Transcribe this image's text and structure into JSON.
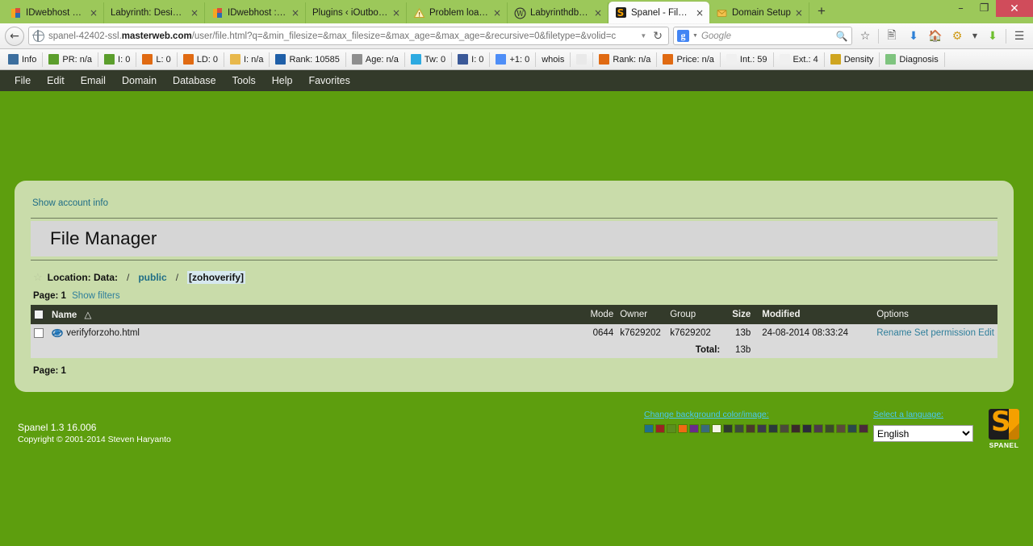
{
  "browser": {
    "tabs": [
      {
        "label": "IDwebhost We...",
        "favicon": "idwebhost-icon",
        "active": false
      },
      {
        "label": "Labyrinth: Design a...",
        "favicon": "blank-icon",
        "active": false
      },
      {
        "label": "IDwebhost :: H...",
        "favicon": "idwebhost-icon",
        "active": false
      },
      {
        "label": "Plugins ‹ iOutboun...",
        "favicon": "blank-icon",
        "active": false
      },
      {
        "label": "Problem loadi...",
        "favicon": "warning-icon",
        "active": false
      },
      {
        "label": "Labyrinthdb.c...",
        "favicon": "wordpress-icon",
        "active": false
      },
      {
        "label": "Spanel - File M...",
        "favicon": "spanel-icon",
        "active": true
      },
      {
        "label": "Domain Setup",
        "favicon": "mail-icon",
        "active": false
      }
    ],
    "new_tab_label": "+",
    "close_label": "×",
    "window_controls": {
      "minimize": "–",
      "restore": "❐",
      "close": "✕"
    },
    "url": {
      "host_prefix": "spanel-42402-ssl.",
      "host_bold": "masterweb.com",
      "path": "/user/file.html?q=&min_filesize=&max_filesize=&max_age=&max_age=&recursive=0&filetype=&volid=c"
    },
    "search": {
      "engine": "Google",
      "placeholder": "Google"
    },
    "nav_icons": [
      "back-icon",
      "bookmark-star-icon",
      "reader-icon",
      "downloads-icon",
      "home-icon",
      "addon-icon",
      "download-helper-icon",
      "menu-icon"
    ]
  },
  "seobar": {
    "items": [
      {
        "label": "Info",
        "icon": "info-icon",
        "color": "#3c6e9e"
      },
      {
        "label": "PR: n/a",
        "icon": "pagerank-icon",
        "color": "#5b9e2c"
      },
      {
        "label": "I: 0",
        "icon": "pagerank-icon",
        "color": "#5b9e2c"
      },
      {
        "label": "L: 0",
        "icon": "links-icon",
        "color": "#e06a12"
      },
      {
        "label": "LD: 0",
        "icon": "links-icon",
        "color": "#e06a12"
      },
      {
        "label": "I: n/a",
        "icon": "index-icon",
        "color": "#e8b84b"
      },
      {
        "label": "Rank: 10585",
        "icon": "alexa-icon",
        "color": "#1f5fa8"
      },
      {
        "label": "Age: n/a",
        "icon": "age-icon",
        "color": "#8e8e8e"
      },
      {
        "label": "Tw: 0",
        "icon": "twitter-icon",
        "color": "#2daae1"
      },
      {
        "label": "I: 0",
        "icon": "facebook-icon",
        "color": "#3b5998"
      },
      {
        "label": "+1: 0",
        "icon": "google-plus-icon",
        "color": "#4e8ef7"
      },
      {
        "label": "whois",
        "icon": "whois-icon",
        "color": ""
      },
      {
        "label": "",
        "icon": "source-icon",
        "color": "#e9e9e9"
      },
      {
        "label": "Rank: n/a",
        "icon": "links-icon",
        "color": "#e06a12"
      },
      {
        "label": "Price: n/a",
        "icon": "links-icon",
        "color": "#e06a12"
      },
      {
        "label": "Int.: 59",
        "icon": "internal-links-icon",
        "color": "#f0f0f0"
      },
      {
        "label": "Ext.: 4",
        "icon": "external-links-icon",
        "color": "#f0f0f0"
      },
      {
        "label": "Density",
        "icon": "density-icon",
        "color": "#cfa520"
      },
      {
        "label": "Diagnosis",
        "icon": "diagnosis-icon",
        "color": "#7fc47f"
      }
    ]
  },
  "menubar": {
    "items": [
      "File",
      "Edit",
      "Email",
      "Domain",
      "Database",
      "Tools",
      "Help",
      "Favorites"
    ]
  },
  "content": {
    "account_link": "Show account info",
    "page_title": "File Manager",
    "location": {
      "star": "☆",
      "label": "Location: Data:",
      "sep": "/",
      "crumbs": [
        "public"
      ],
      "current": "[zohoverify]"
    },
    "page_top": {
      "label": "Page:",
      "value": "1",
      "filters_link": "Show filters"
    },
    "page_bottom": {
      "label": "Page:",
      "value": "1"
    },
    "table": {
      "columns": [
        "Name",
        "Mode",
        "Owner",
        "Group",
        "Size",
        "Modified",
        "Options"
      ],
      "sort_indicator": "△",
      "rows": [
        {
          "name": "verifyforzoho.html",
          "icon": "ie-document-icon",
          "mode": "0644",
          "owner": "k7629202",
          "group": "k7629202",
          "size": "13b",
          "modified": "24-08-2014 08:33:24",
          "options": [
            "Rename",
            "Set permission",
            "Edit"
          ]
        }
      ],
      "total_label": "Total:",
      "total_value": "13b"
    }
  },
  "footer": {
    "version": "Spanel 1.3 16.006",
    "copyright": "Copyright © 2001-2014 Steven Haryanto",
    "bg_link": "Change background color/image:",
    "swatches": [
      "#1f6f8b",
      "#9b2323",
      "#5a8f1f",
      "#ef6a12",
      "#6a2a8b",
      "#3a6a7a",
      "#f4f4e8",
      "#2e3a2e",
      "#3b4a3b",
      "#4a3a2a",
      "#3a3a4a",
      "#2a3a3a",
      "#4a4a3a",
      "#3a2a2a",
      "#2a2a3a",
      "#4a3a4a",
      "#3a4a2a",
      "#5a4a3a",
      "#2a4a4a",
      "#4a2a3a"
    ],
    "lang_link": "Select a language:",
    "lang_options": [
      "English"
    ],
    "lang_selected": "English",
    "logo_text": "SPANEL"
  },
  "colors": {
    "page_bg": "#5d9e0e",
    "card_bg": "#c9dcaa",
    "chrome_bg": "#9cc85a",
    "menubar_bg": "#333a2a",
    "link": "#2f7f9b"
  }
}
